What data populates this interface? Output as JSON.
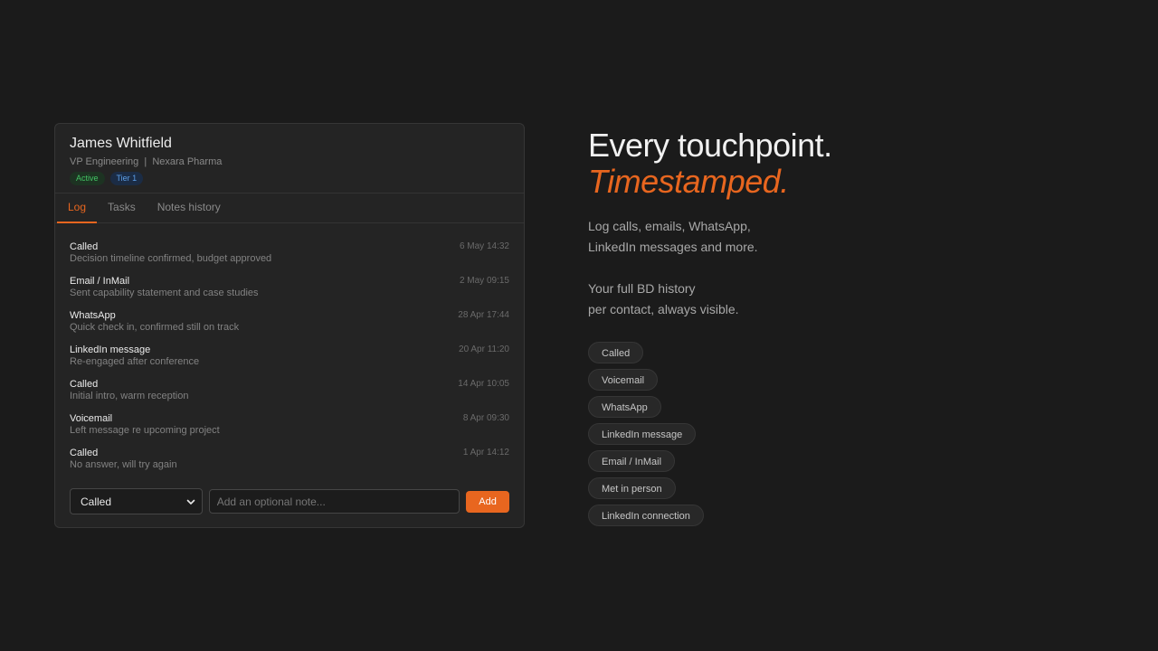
{
  "contact": {
    "name": "James Whitfield",
    "meta": "VP Engineering  |  Nexara Pharma",
    "status_badge": "Active",
    "tier_badge": "Tier 1"
  },
  "tabs": [
    {
      "label": "Log",
      "active": true
    },
    {
      "label": "Tasks",
      "active": false
    },
    {
      "label": "Notes history",
      "active": false
    }
  ],
  "log": [
    {
      "type": "Called",
      "note": "Decision timeline confirmed, budget approved",
      "time": "6 May 14:32"
    },
    {
      "type": "Email / InMail",
      "note": "Sent capability statement and case studies",
      "time": "2 May 09:15"
    },
    {
      "type": "WhatsApp",
      "note": "Quick check in, confirmed still on track",
      "time": "28 Apr 17:44"
    },
    {
      "type": "LinkedIn message",
      "note": "Re-engaged after conference",
      "time": "20 Apr 11:20"
    },
    {
      "type": "Called",
      "note": "Initial intro, warm reception",
      "time": "14 Apr 10:05"
    },
    {
      "type": "Voicemail",
      "note": "Left message re upcoming project",
      "time": "8 Apr 09:30"
    },
    {
      "type": "Called",
      "note": "No answer, will try again",
      "time": "1 Apr 14:12"
    }
  ],
  "add_form": {
    "selected_type": "Called",
    "note_placeholder": "Add an optional note...",
    "add_label": "Add"
  },
  "hero": {
    "line1": "Every touchpoint.",
    "line2": "Timestamped.",
    "desc1_line1": "Log calls, emails, WhatsApp,",
    "desc1_line2": "LinkedIn messages and more.",
    "desc2_line1": "Your full BD history",
    "desc2_line2": "per contact, always visible."
  },
  "chips": [
    "Called",
    "Voicemail",
    "WhatsApp",
    "LinkedIn message",
    "Email / InMail",
    "Met in person",
    "LinkedIn connection"
  ],
  "colors": {
    "accent": "#e8661f",
    "background": "#1b1b1b",
    "card": "#242424",
    "active_green": "#43c464",
    "tier_blue": "#5c9fe8"
  }
}
